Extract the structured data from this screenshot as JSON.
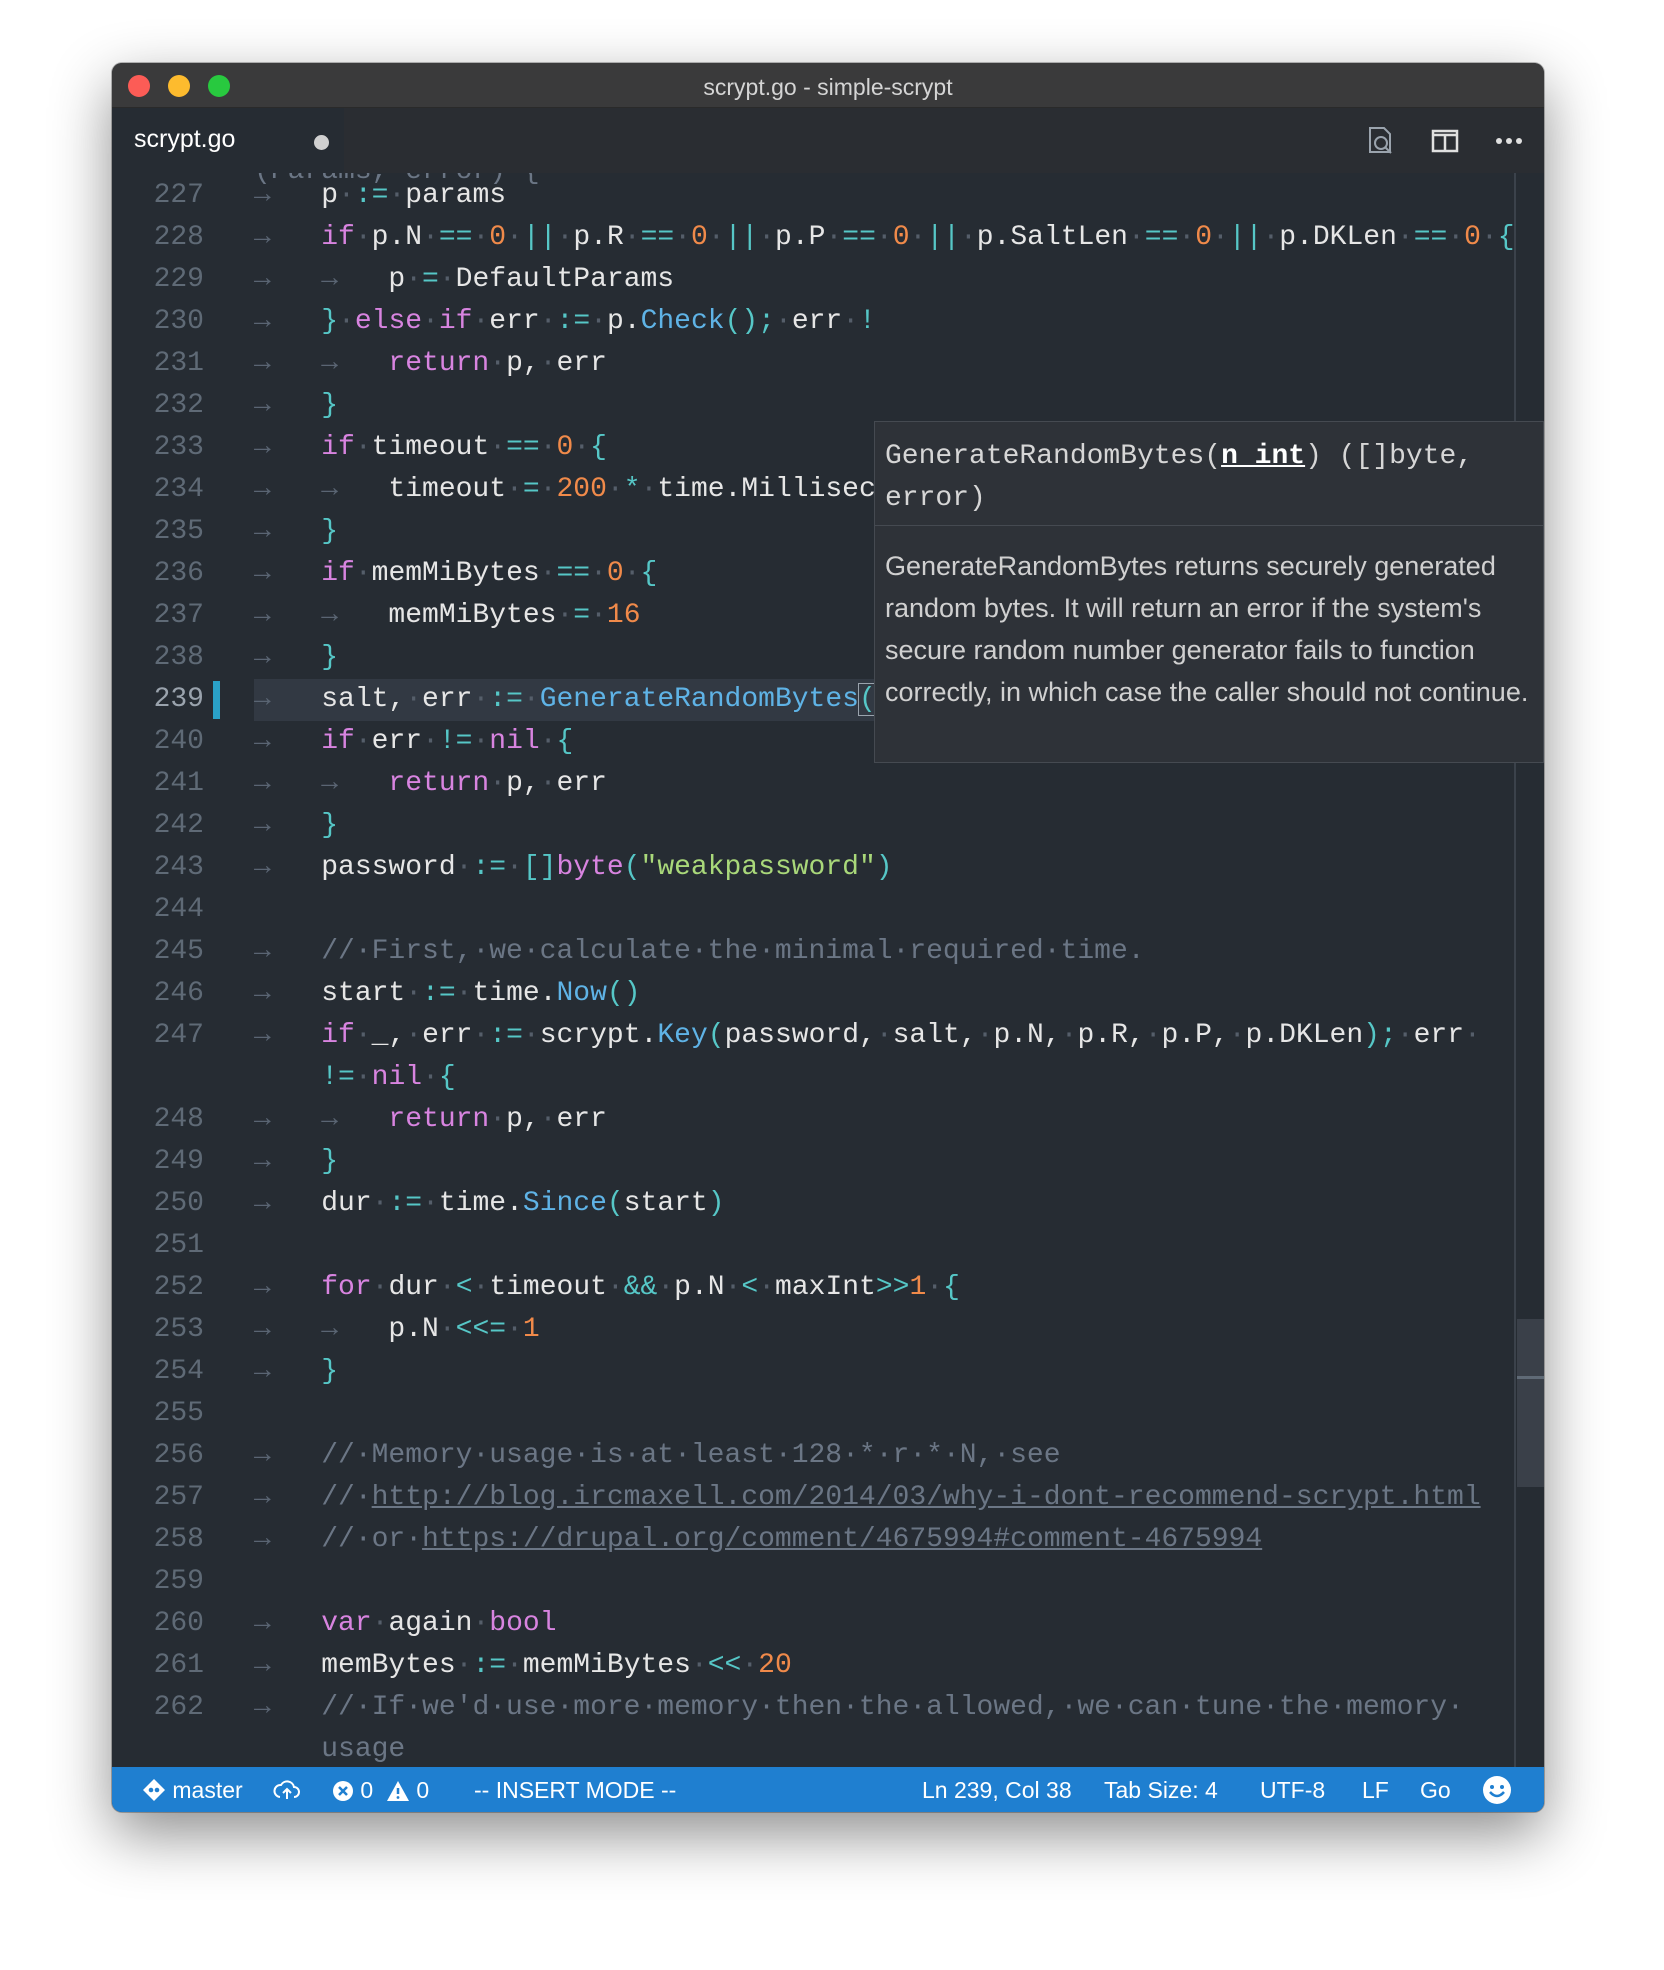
{
  "window": {
    "title": "scrypt.go - simple-scrypt"
  },
  "tab": {
    "label": "scrypt.go",
    "modified_indicator": "dirty-dot"
  },
  "toolbar": {
    "icons": [
      "search-preview-icon",
      "split-editor-icon",
      "more-icon"
    ]
  },
  "editor": {
    "cursor_line": "239",
    "lines": [
      {
        "n": "227",
        "text": "p := params"
      },
      {
        "n": "228",
        "text": "if p.N == 0 || p.R == 0 || p.P == 0 || p.SaltLen == 0 || p.DKLen == 0 {"
      },
      {
        "n": "229",
        "text": "p = DefaultParams"
      },
      {
        "n": "230",
        "text": "} else if err := p.Check(); err !"
      },
      {
        "n": "231",
        "text": "return p, err"
      },
      {
        "n": "232",
        "text": "}"
      },
      {
        "n": "233",
        "text": "if timeout == 0 {"
      },
      {
        "n": "234",
        "text": "timeout = 200 * time.Millisec"
      },
      {
        "n": "235",
        "text": "}"
      },
      {
        "n": "236",
        "text": "if memMiBytes == 0 {"
      },
      {
        "n": "237",
        "text": "memMiBytes = 16"
      },
      {
        "n": "238",
        "text": "}"
      },
      {
        "n": "239",
        "text": "salt, err := GenerateRandomBytes()"
      },
      {
        "n": "240",
        "text": "if err != nil {"
      },
      {
        "n": "241",
        "text": "return p, err"
      },
      {
        "n": "242",
        "text": "}"
      },
      {
        "n": "243",
        "text": "password := []byte(\"weakpassword\")"
      },
      {
        "n": "244",
        "text": ""
      },
      {
        "n": "245",
        "text": "// First, we calculate the minimal required time."
      },
      {
        "n": "246",
        "text": "start := time.Now()"
      },
      {
        "n": "247",
        "text": "if _, err := scrypt.Key(password, salt, p.N, p.R, p.P, p.DKLen); err != nil {"
      },
      {
        "n": "248",
        "text": "return p, err"
      },
      {
        "n": "249",
        "text": "}"
      },
      {
        "n": "250",
        "text": "dur := time.Since(start)"
      },
      {
        "n": "251",
        "text": ""
      },
      {
        "n": "252",
        "text": "for dur < timeout && p.N < maxInt>>1 {"
      },
      {
        "n": "253",
        "text": "p.N <<= 1"
      },
      {
        "n": "254",
        "text": "}"
      },
      {
        "n": "255",
        "text": ""
      },
      {
        "n": "256",
        "text": "// Memory usage is at least 128 * r * N, see"
      },
      {
        "n": "257",
        "text": "// http://blog.ircmaxell.com/2014/03/why-i-dont-recommend-scrypt.html"
      },
      {
        "n": "258",
        "text": "// or https://drupal.org/comment/4675994#comment-4675994"
      },
      {
        "n": "259",
        "text": ""
      },
      {
        "n": "260",
        "text": "var again bool"
      },
      {
        "n": "261",
        "text": "memBytes := memMiBytes << 20"
      },
      {
        "n": "262",
        "text": "// If we'd use more memory then the allowed, we can tune the memory usage"
      }
    ],
    "partial_top_text": "(Params, error) {"
  },
  "hover": {
    "signature_name": "GenerateRandomBytes(",
    "signature_param": "n int",
    "signature_rest": ") ([]byte,",
    "signature_line2": "error)",
    "doc": "GenerateRandomBytes returns securely generated random bytes. It will return an error if the system's secure random number generator fails to function correctly, in which case the caller should not continue."
  },
  "statusbar": {
    "branch": "master",
    "errors": "0",
    "warnings": "0",
    "mode": "-- INSERT MODE --",
    "position": "Ln 239, Col 38",
    "tab_size": "Tab Size: 4",
    "encoding": "UTF-8",
    "eol": "LF",
    "language": "Go"
  },
  "colors": {
    "editor_bg": "#262c33",
    "status_bg": "#1f7fd0",
    "keyword": "#d884e0",
    "number": "#f08a4a",
    "string": "#a9d87a",
    "function": "#5fb3e6",
    "operator": "#56c7c7",
    "comment": "#6b7685"
  }
}
